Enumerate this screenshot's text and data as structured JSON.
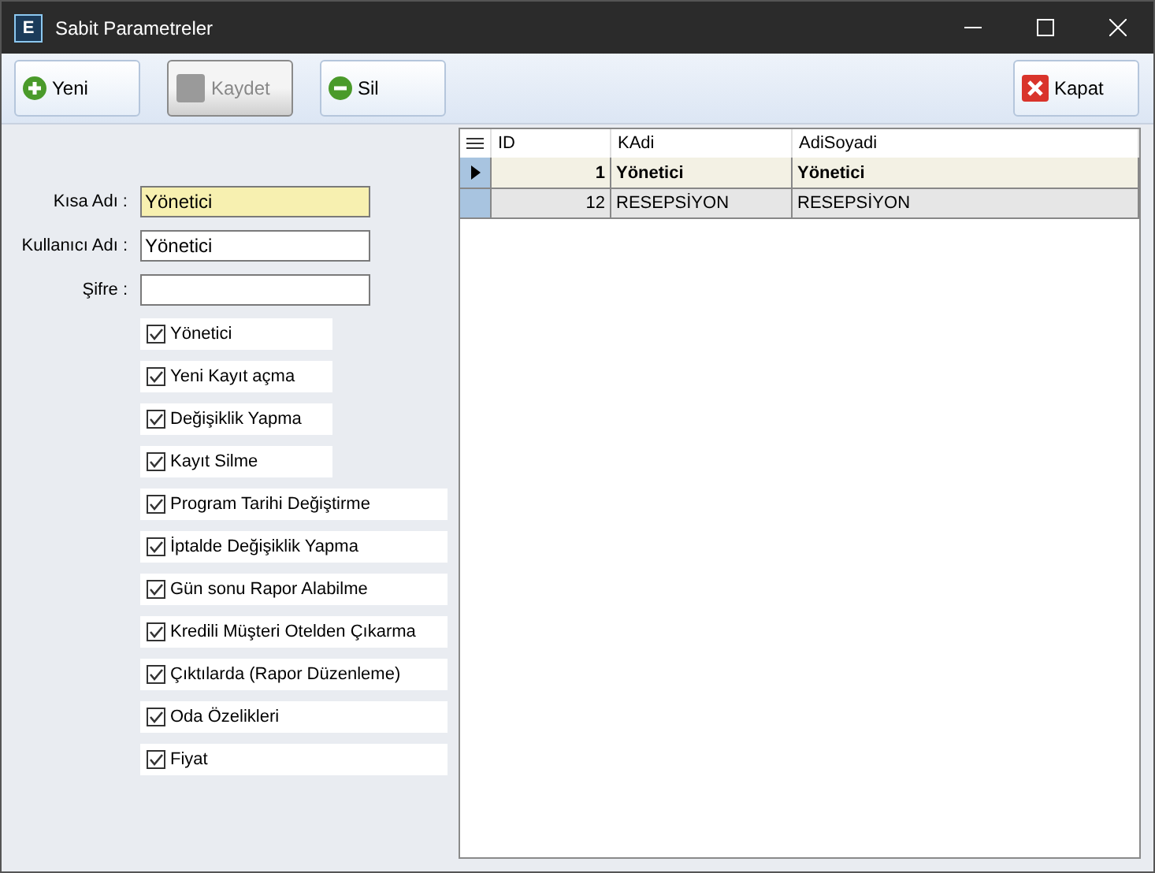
{
  "window": {
    "title": "Sabit Parametreler",
    "icon_letter": "E"
  },
  "toolbar": [
    {
      "label": "Yeni",
      "kind": "add",
      "disabled": false
    },
    {
      "label": "Kaydet",
      "kind": "save",
      "disabled": true
    },
    {
      "label": "Sil",
      "kind": "delete",
      "disabled": false
    },
    {
      "label": "Kapat",
      "kind": "close",
      "disabled": false
    }
  ],
  "fields": [
    {
      "label": "Kısa Adı :",
      "value": "Yönetici",
      "focused": true
    },
    {
      "label": "Kullanıcı Adı :",
      "value": "Yönetici",
      "focused": false
    },
    {
      "label": "Şifre :",
      "focused": false
    }
  ],
  "permissions": [
    {
      "label": "Yönetici",
      "checked": true
    },
    {
      "label": "Yeni Kayıt açma",
      "checked": true
    },
    {
      "label": "Değişiklik Yapma",
      "checked": true
    },
    {
      "label": "Kayıt Silme",
      "checked": true
    },
    {
      "label": "Program Tarihi Değiştirme",
      "checked": true
    },
    {
      "label": "İptalde Değişiklik Yapma",
      "checked": true
    },
    {
      "label": "Gün sonu Rapor Alabilme",
      "checked": true
    },
    {
      "label": "Kredili Müşteri Otelden Çıkarma",
      "checked": true
    },
    {
      "label": "Çıktılarda (Rapor Düzenleme)",
      "checked": true
    },
    {
      "label": "Oda Özelikleri",
      "checked": true
    },
    {
      "label": "Fiyat",
      "checked": true
    }
  ],
  "table": {
    "columns": [
      "ID",
      "KAdi",
      "AdiSoyadi"
    ],
    "rows": [
      {
        "cells": [
          "1",
          "Yönetici",
          "Yönetici"
        ],
        "selected": true
      },
      {
        "cells": [
          "12",
          "RESEPSİYON",
          "RESEPSİYON"
        ],
        "selected": false
      }
    ]
  }
}
